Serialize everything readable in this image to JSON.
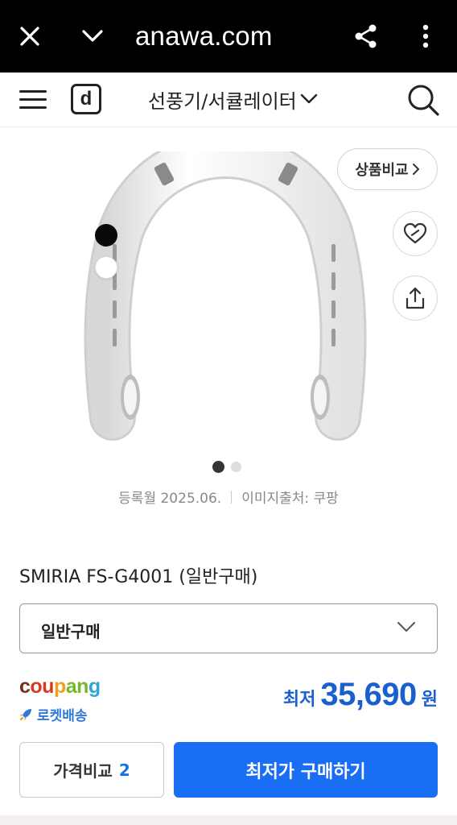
{
  "browser": {
    "url": "anawa.com",
    "icons": [
      "close-icon",
      "chevron-down-icon",
      "share-icon",
      "more-vertical-icon"
    ]
  },
  "header": {
    "logo": "d",
    "category": "선풍기/서큘레이터",
    "icons": [
      "menu-icon",
      "chevron-down-icon",
      "search-icon"
    ]
  },
  "gallery": {
    "compare_label": "상품비교",
    "page_count": 2,
    "active_page": 1,
    "colors": [
      "#0a0a0a",
      "#ffffff"
    ],
    "icons": [
      "heart-icon",
      "share-upload-icon"
    ]
  },
  "meta": {
    "registered": "등록월 2025.06.",
    "image_source": "이미지출처: 쿠팡"
  },
  "product": {
    "title": "SMIRIA FS-G4001 (일반구매)",
    "option_selected": "일반구매"
  },
  "seller": {
    "logo_parts": [
      "c",
      "ou",
      "p",
      "an",
      "g"
    ],
    "delivery": "로켓배송"
  },
  "price": {
    "prefix": "최저",
    "value": "35,690",
    "unit": "원"
  },
  "actions": {
    "compare_label": "가격비교",
    "compare_count": "2",
    "buy_label": "최저가 구매하기"
  },
  "colors": {
    "accent": "#1a6ef3",
    "price": "#1a5fd0"
  }
}
